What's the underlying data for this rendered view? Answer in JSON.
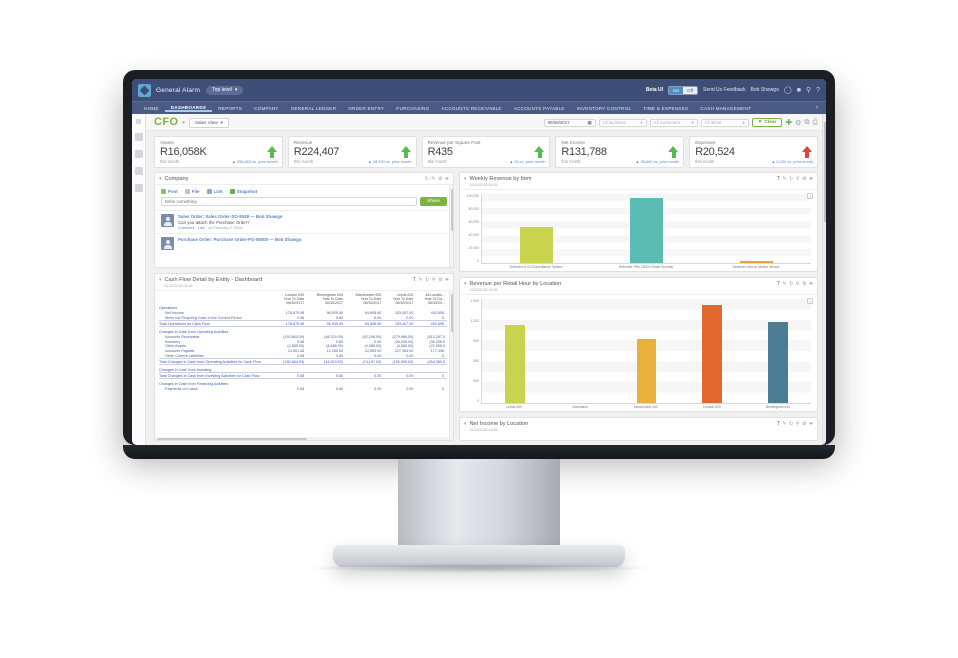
{
  "brand": {
    "company": "General Alarm",
    "scope_pill": "Top level",
    "beta_label": "Beta UI",
    "toggle_on": "On",
    "toggle_off": "Off",
    "feedback": "Send Us Feedback",
    "user": "Bob Shawgo",
    "icons": [
      "chat-icon",
      "book-icon",
      "search-icon",
      "help-icon"
    ]
  },
  "nav": {
    "items": [
      "HOME",
      "DASHBOARDS",
      "REPORTS",
      "COMPANY",
      "GENERAL LEDGER",
      "ORDER ENTRY",
      "PURCHASING",
      "ACCOUNTS RECEIVABLE",
      "ACCOUNTS PAYABLE",
      "INVENTORY CONTROL",
      "TIME & EXPENSES",
      "CASH MANAGEMENT"
    ],
    "active": "DASHBOARDS",
    "more": "›"
  },
  "page": {
    "title": "CFO",
    "view_selector": "Sales View",
    "date": "06/08/2017",
    "filter_locations": "All locations",
    "filter_customers": "All customers",
    "filter_items": "All items",
    "clear_label": "Clear",
    "toolbar_icons": [
      "add-icon",
      "gear-icon",
      "copy-icon",
      "print-icon"
    ]
  },
  "kpis": [
    {
      "label": "Assets",
      "value": "R16,058K",
      "period": "this month",
      "delta": "▲ 258,663 vs. prior month",
      "direction": "up"
    },
    {
      "label": "Revenue",
      "value": "R224,407",
      "period": "this month",
      "delta": "▲ 18,934 vs. prior month",
      "direction": "up"
    },
    {
      "label": "Revenue per Square Foot",
      "value": "R435",
      "period": "this month",
      "delta": "▲ 39 vs. prior month",
      "direction": "up"
    },
    {
      "label": "Net Income",
      "value": "R131,788",
      "period": "this month",
      "delta": "▲ 38,840 vs. prior month",
      "direction": "up"
    },
    {
      "label": "Expenses",
      "value": "R20,524",
      "period": "this month",
      "delta": "▲ 8,200 vs. prior month",
      "direction": "up-red"
    }
  ],
  "company_panel": {
    "title": "Company",
    "actions": [
      "Post",
      "File",
      "Link",
      "Snapshot"
    ],
    "composer_placeholder": "Write something",
    "share_label": "Share",
    "feed": [
      {
        "title": "Sales Order: Sales Order-SO-8048 — Bob Shawgo",
        "text": "Can you attach the Purchase Order?",
        "meta_comment": "Comment",
        "meta_like": "Like",
        "meta_date": "on February 2, 2018"
      },
      {
        "title": "Purchase Order: Purchase Order-PO-08000 — Bob Shawgo",
        "text": "",
        "meta_comment": "",
        "meta_like": "",
        "meta_date": ""
      }
    ]
  },
  "cashflow_panel": {
    "title": "Cash Flow Detail by Entity - Dashboard",
    "timestamp": "02/15/2018 04:48",
    "columns": [
      {
        "name": "London #30",
        "period": "Year To Date",
        "date": "06/30/2017"
      },
      {
        "name": "Birmingham #43",
        "period": "Year To Date",
        "date": "06/30/2017"
      },
      {
        "name": "Manchester #30",
        "period": "Year To Date",
        "date": "06/30/2017"
      },
      {
        "name": "Leeds #10",
        "period": "Year To Date",
        "date": "06/30/2017"
      },
      {
        "name": "All Locatio...",
        "period": "Year To Da...",
        "date": "06/30/20..."
      }
    ],
    "rows": [
      {
        "kind": "group",
        "label": "Operations",
        "values": [
          "",
          "",
          "",
          "",
          ""
        ]
      },
      {
        "kind": "sub",
        "label": "Net Income",
        "values": [
          "178,675.08",
          "96,935.50",
          "69,808.60",
          "153,407.00",
          "492,605."
        ]
      },
      {
        "kind": "sub",
        "label": "Items not Requiring Cash in the Current Period",
        "values": [
          "0.08",
          "0.80",
          "0.00",
          "0.00",
          "0."
        ]
      },
      {
        "kind": "total",
        "label": "Total Operations for Cash Flow",
        "values": [
          "178,675.08",
          "96,935.50",
          "69,808.60",
          "153,407.00",
          "492,605."
        ]
      },
      {
        "kind": "spacer",
        "label": "",
        "values": [
          "",
          "",
          "",
          "",
          ""
        ]
      },
      {
        "kind": "group",
        "label": "Changes in Cash from Operating Activities",
        "values": [
          "",
          "",
          "",
          "",
          ""
        ]
      },
      {
        "kind": "sub",
        "label": "Accounts Receivable",
        "values": [
          "(193,800.09)",
          "(48,224.00)",
          "(92,198.00)",
          "(279,985.00)",
          "(613,287.0"
        ]
      },
      {
        "kind": "sub",
        "label": "Inventory",
        "values": [
          "0.08",
          "0.80",
          "0.00",
          "(36,296.00)",
          "(36,296.0"
        ]
      },
      {
        "kind": "sub",
        "label": "Other Assets",
        "values": [
          "(4,585.00)",
          "(8,585.00)",
          "(4,585.00)",
          "(4,585.00)",
          "(23,395.0"
        ]
      },
      {
        "kind": "sub",
        "label": "Accounts Payable",
        "values": [
          "14,501.08",
          "12,285.50",
          "22,509.00",
          "127,364.00",
          "177,498."
        ]
      },
      {
        "kind": "sub",
        "label": "Other Current Liabilities",
        "values": [
          "0.08",
          "0.80",
          "0.00",
          "0.00",
          "0."
        ]
      },
      {
        "kind": "total",
        "label": "Total Changes in Cash from Operating Activities for Cash Flow",
        "values": [
          "(182,664.09)",
          "(44,523.50)",
          "(74,197.00)",
          "(192,995.00)",
          "(494,380.0"
        ]
      },
      {
        "kind": "spacer",
        "label": "",
        "values": [
          "",
          "",
          "",
          "",
          ""
        ]
      },
      {
        "kind": "group",
        "label": "Changes in Cash from Investing",
        "values": [
          "",
          "",
          "",
          "",
          ""
        ]
      },
      {
        "kind": "total",
        "label": "Total Changes in Cash from Investing Activities for Cash Flow",
        "values": [
          "0.08",
          "0.80",
          "0.00",
          "0.00",
          "0."
        ]
      },
      {
        "kind": "spacer",
        "label": "",
        "values": [
          "",
          "",
          "",
          "",
          ""
        ]
      },
      {
        "kind": "group",
        "label": "Changes in Cash from Financing Activities",
        "values": [
          "",
          "",
          "",
          "",
          ""
        ]
      },
      {
        "kind": "sub",
        "label": "Payments on Loans",
        "values": [
          "0.08",
          "0.80",
          "0.00",
          "0.00",
          "0."
        ]
      }
    ]
  },
  "weekly_revenue_panel": {
    "title": "Weekly Revenue by Item",
    "timestamp": "02/15/2018 04:55"
  },
  "retail_hour_panel": {
    "title": "Revenue per Retail Hour by Location",
    "timestamp": "02/15/2018 04:55"
  },
  "net_income_panel": {
    "title": "Net Income by Location",
    "timestamp": "02/15/2018 04:55"
  },
  "panel_tool_icons": [
    "filter-icon",
    "edit-icon",
    "refresh-icon",
    "search-icon",
    "gear-icon",
    "delete-icon"
  ],
  "chart_data": [
    {
      "type": "bar",
      "title": "Weekly Revenue by Item",
      "categories": [
        "Defender 8 CH Surveillance System",
        "Defender PRo 1800H Smart Security",
        "Defender Add-on Motion Sensor"
      ],
      "values": [
        51000,
        93000,
        2000
      ],
      "colors": [
        "#c8d44e",
        "#5bbcb4",
        "#e8a33d"
      ],
      "xlabel": "",
      "ylabel": "",
      "ylim": [
        0,
        100000
      ],
      "yticks": [
        "0",
        "20,000",
        "40,000",
        "60,000",
        "80,000",
        "100,000"
      ],
      "grid": true,
      "legend": "none"
    },
    {
      "type": "bar",
      "title": "Revenue per Retail Hour by Location",
      "categories": [
        "Leeds #30",
        "Omnisalon",
        "Manchester #40",
        "London #20",
        "Birmingham #10"
      ],
      "values": [
        1120,
        0,
        910,
        1400,
        1160
      ],
      "colors": [
        "#c8d44e",
        "#00000000",
        "#eab03c",
        "#e2682e",
        "#4b7e96"
      ],
      "xlabel": "",
      "ylabel": "",
      "ylim": [
        0,
        1500
      ],
      "yticks": [
        "0",
        "300",
        "600",
        "900",
        "1,200",
        "1,500"
      ],
      "grid": true,
      "legend": "none"
    }
  ]
}
